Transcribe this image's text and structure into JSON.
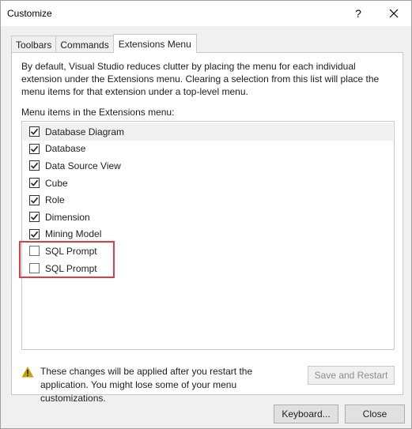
{
  "window": {
    "title": "Customize",
    "help_glyph": "?"
  },
  "tabs": [
    {
      "label": "Toolbars"
    },
    {
      "label": "Commands"
    },
    {
      "label": "Extensions Menu"
    }
  ],
  "active_tab": "Extensions Menu",
  "panel": {
    "description": "By default, Visual Studio reduces clutter by placing the menu for each individual extension under the Extensions menu. Clearing a selection from this list will place the menu items for that extension under a top-level menu.",
    "list_label": "Menu items in the Extensions menu:",
    "items": [
      {
        "label": "Database Diagram",
        "checked": true
      },
      {
        "label": "Database",
        "checked": true
      },
      {
        "label": "Data Source View",
        "checked": true
      },
      {
        "label": "Cube",
        "checked": true
      },
      {
        "label": "Role",
        "checked": true
      },
      {
        "label": "Dimension",
        "checked": true
      },
      {
        "label": "Mining Model",
        "checked": true
      },
      {
        "label": "SQL Prompt",
        "checked": false
      },
      {
        "label": "SQL Prompt",
        "checked": false
      }
    ],
    "warning_text": "These changes will be applied after you restart the application. You might lose some of your menu customizations.",
    "save_restart_label": "Save and Restart"
  },
  "footer": {
    "keyboard_label": "Keyboard...",
    "close_label": "Close"
  },
  "colors": {
    "highlight": "#e03c46",
    "warning": "#c8a000"
  }
}
